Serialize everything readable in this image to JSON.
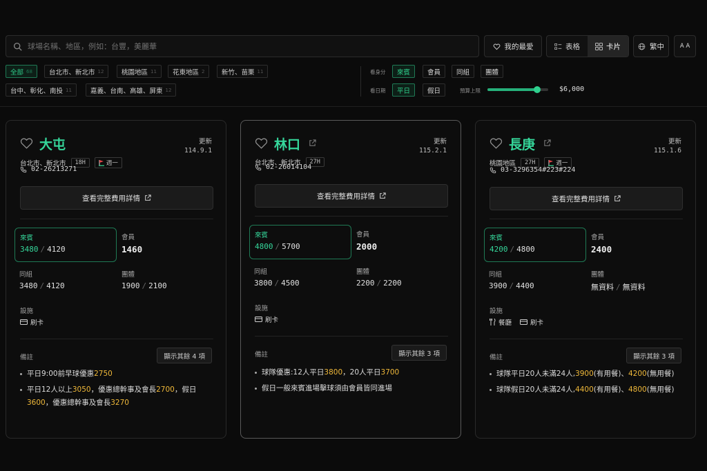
{
  "search": {
    "placeholder": "球場名稱、地區，例如：台豐，美麗華"
  },
  "topbar": {
    "favorites_label": "我的最愛",
    "view_table_label": "表格",
    "view_card_label": "卡片",
    "lang_label": "繁中",
    "font_label": "A A"
  },
  "region_filters": [
    {
      "label": "全部",
      "count": "68",
      "active": true
    },
    {
      "label": "台北市、新北市",
      "count": "12"
    },
    {
      "label": "桃園地區",
      "count": "11"
    },
    {
      "label": "花東地區",
      "count": "2"
    },
    {
      "label": "新竹、苗栗",
      "count": "11"
    },
    {
      "label": "台中、彰化、南投",
      "count": "11"
    },
    {
      "label": "嘉義、台南、高雄、屏東",
      "count": "12"
    }
  ],
  "identity_filter": {
    "label": "看身分",
    "options": [
      "來賓",
      "會員",
      "同組",
      "團體"
    ],
    "active": "來賓"
  },
  "day_filter": {
    "label": "看日期",
    "options": [
      "平日",
      "假日"
    ],
    "active": "平日"
  },
  "budget": {
    "label": "預算上限",
    "value_text": "$6,000",
    "fraction": 0.82
  },
  "common": {
    "update_label": "更新",
    "detail_label": "查看完整費用詳情",
    "guest_label": "來賓",
    "member_label": "會員",
    "group_label": "同組",
    "team_label": "團體",
    "facilities_label": "設施",
    "notes_label": "備註",
    "slash": "/"
  },
  "cards": [
    {
      "name": "大屯",
      "update_date": "114.9.1",
      "region": "台北市、新北市",
      "holes": "18H",
      "closed_day": "週一",
      "phone": "02-26213271",
      "guest": [
        "3480",
        "4120"
      ],
      "member": "1460",
      "group": [
        "3480",
        "4120"
      ],
      "team": [
        "1900",
        "2100"
      ],
      "facilities": [
        "刷卡"
      ],
      "more_label": "顯示其餘 4 項",
      "notes": [
        [
          {
            "t": "平日9:00前早球優惠"
          },
          {
            "t": "2750",
            "h": true
          }
        ],
        [
          {
            "t": "平日12人以上"
          },
          {
            "t": "3050",
            "h": true
          },
          {
            "t": "，優惠總幹事及會長"
          },
          {
            "t": "2700",
            "h": true
          },
          {
            "t": "，假日"
          },
          {
            "t": "3600",
            "h": true
          },
          {
            "t": "，優惠總幹事及會長"
          },
          {
            "t": "3270",
            "h": true
          }
        ]
      ]
    },
    {
      "name": "林口",
      "update_date": "115.2.1",
      "region": "台北市、新北市",
      "holes": "27H",
      "closed_day": "",
      "phone": "02-26014104",
      "guest": [
        "4800",
        "5700"
      ],
      "member": "2000",
      "group": [
        "3800",
        "4500"
      ],
      "team": [
        "2200",
        "2200"
      ],
      "facilities": [
        "刷卡"
      ],
      "more_label": "顯示其餘 3 項",
      "notes": [
        [
          {
            "t": "球隊優惠:12人平日"
          },
          {
            "t": "3800",
            "h": true
          },
          {
            "t": "，20人平日"
          },
          {
            "t": "3700",
            "h": true
          }
        ],
        [
          {
            "t": "假日一般來賓進場擊球須由會員皆同進場"
          }
        ]
      ]
    },
    {
      "name": "長庚",
      "update_date": "115.1.6",
      "region": "桃園地區",
      "holes": "27H",
      "closed_day": "週一",
      "phone": "03-3296354#223#224",
      "guest": [
        "4200",
        "4800"
      ],
      "member": "2400",
      "group": [
        "3900",
        "4400"
      ],
      "team": [
        "無資料",
        "無資料"
      ],
      "facilities": [
        "餐廳",
        "刷卡"
      ],
      "more_label": "顯示其餘 3 項",
      "notes": [
        [
          {
            "t": "球隊平日20人未滿24人,"
          },
          {
            "t": "3900",
            "h": true
          },
          {
            "t": "(有用餐)、"
          },
          {
            "t": "4200",
            "h": true
          },
          {
            "t": "(無用餐)"
          }
        ],
        [
          {
            "t": "球隊假日20人未滿24人,"
          },
          {
            "t": "4400",
            "h": true
          },
          {
            "t": "(有用餐)、"
          },
          {
            "t": "4800",
            "h": true
          },
          {
            "t": "(無用餐)"
          }
        ]
      ]
    }
  ]
}
